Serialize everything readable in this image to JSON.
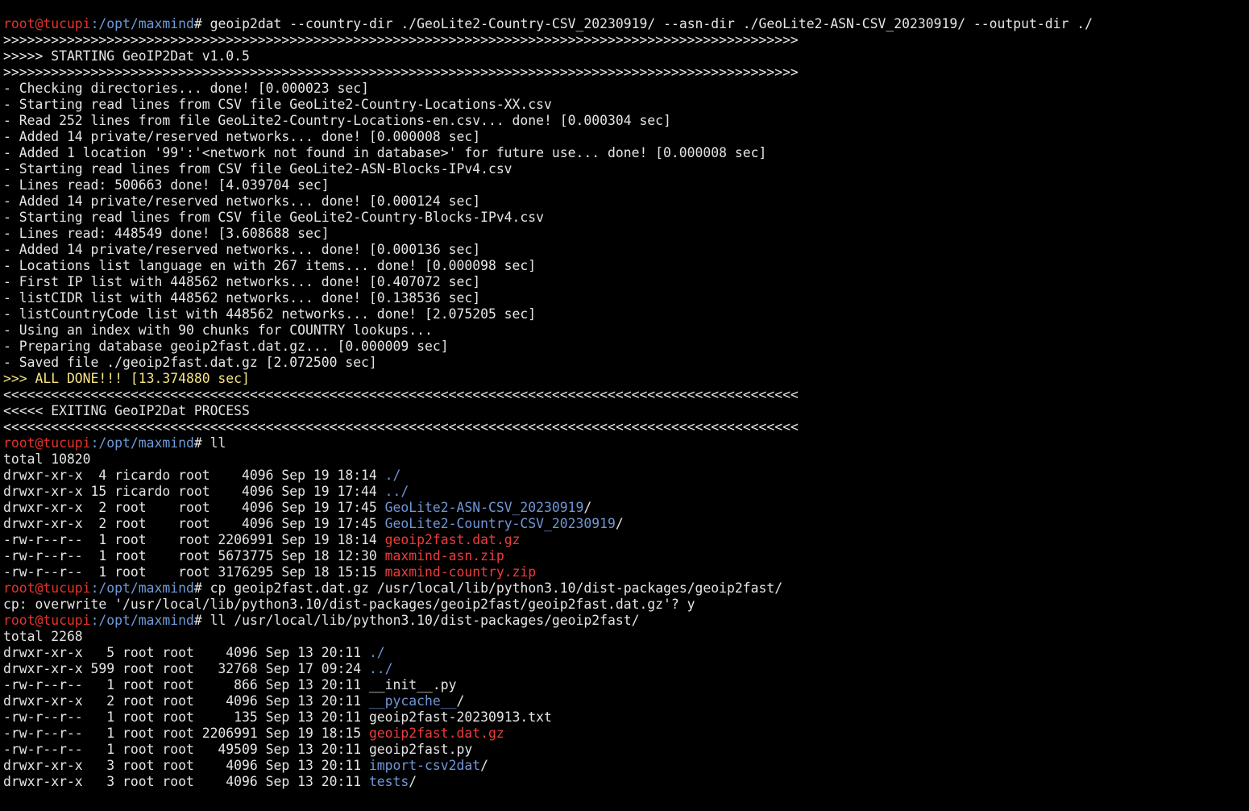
{
  "colors": {
    "background": "#000000",
    "text": "#e5e5e5",
    "prompt_user": "#e5322d",
    "prompt_path": "#6f9bd8",
    "directory": "#7096d6",
    "archive": "#ee3b3b",
    "highlight": "#f7e480"
  },
  "prompt": {
    "user_host": "root@tucupi",
    "path": ":/opt/maxmind",
    "symbol": "# "
  },
  "top_fragment": "    ,     .   ,",
  "lines": [
    {
      "type": "cmd",
      "text": "geoip2dat --country-dir ./GeoLite2-Country-CSV_20230919/ --asn-dir ./GeoLite2-ASN-CSV_20230919/ --output-dir ./"
    },
    {
      "type": "out",
      "text": ">>>>>>>>>>>>>>>>>>>>>>>>>>>>>>>>>>>>>>>>>>>>>>>>>>>>>>>>>>>>>>>>>>>>>>>>>>>>>>>>>>>>>>>>>>>>>>>>>>>>"
    },
    {
      "type": "out",
      "text": ">>>>> STARTING GeoIP2Dat v1.0.5"
    },
    {
      "type": "out",
      "text": ">>>>>>>>>>>>>>>>>>>>>>>>>>>>>>>>>>>>>>>>>>>>>>>>>>>>>>>>>>>>>>>>>>>>>>>>>>>>>>>>>>>>>>>>>>>>>>>>>>>>"
    },
    {
      "type": "out",
      "text": "- Checking directories... done! [0.000023 sec]"
    },
    {
      "type": "out",
      "text": "- Starting read lines from CSV file GeoLite2-Country-Locations-XX.csv"
    },
    {
      "type": "out",
      "text": "- Read 252 lines from file GeoLite2-Country-Locations-en.csv... done! [0.000304 sec]"
    },
    {
      "type": "out",
      "text": "- Added 14 private/reserved networks... done! [0.000008 sec]"
    },
    {
      "type": "out",
      "text": "- Added 1 location '99':'<network not found in database>' for future use... done! [0.000008 sec]"
    },
    {
      "type": "out",
      "text": "- Starting read lines from CSV file GeoLite2-ASN-Blocks-IPv4.csv"
    },
    {
      "type": "out",
      "text": "- Lines read: 500663 done! [4.039704 sec]"
    },
    {
      "type": "out",
      "text": "- Added 14 private/reserved networks... done! [0.000124 sec]"
    },
    {
      "type": "out",
      "text": "- Starting read lines from CSV file GeoLite2-Country-Blocks-IPv4.csv"
    },
    {
      "type": "out",
      "text": "- Lines read: 448549 done! [3.608688 sec]"
    },
    {
      "type": "out",
      "text": "- Added 14 private/reserved networks... done! [0.000136 sec]"
    },
    {
      "type": "out",
      "text": "- Locations list language en with 267 items... done! [0.000098 sec]"
    },
    {
      "type": "out",
      "text": "- First IP list with 448562 networks... done! [0.407072 sec]"
    },
    {
      "type": "out",
      "text": "- listCIDR list with 448562 networks... done! [0.138536 sec]"
    },
    {
      "type": "out",
      "text": "- listCountryCode list with 448562 networks... done! [2.075205 sec]"
    },
    {
      "type": "out",
      "text": "- Using an index with 90 chunks for COUNTRY lookups..."
    },
    {
      "type": "out",
      "text": "- Preparing database geoip2fast.dat.gz... [0.000009 sec]"
    },
    {
      "type": "out",
      "text": "- Saved file ./geoip2fast.dat.gz [2.072500 sec]"
    },
    {
      "type": "highlight",
      "text": ">>> ALL DONE!!! [13.374880 sec]"
    },
    {
      "type": "out",
      "text": "<<<<<<<<<<<<<<<<<<<<<<<<<<<<<<<<<<<<<<<<<<<<<<<<<<<<<<<<<<<<<<<<<<<<<<<<<<<<<<<<<<<<<<<<<<<<<<<<<<<<"
    },
    {
      "type": "out",
      "text": "<<<<< EXITING GeoIP2Dat PROCESS"
    },
    {
      "type": "out",
      "text": "<<<<<<<<<<<<<<<<<<<<<<<<<<<<<<<<<<<<<<<<<<<<<<<<<<<<<<<<<<<<<<<<<<<<<<<<<<<<<<<<<<<<<<<<<<<<<<<<<<<<"
    },
    {
      "type": "cmd",
      "text": "ll"
    },
    {
      "type": "out",
      "text": "total 10820"
    },
    {
      "type": "ls",
      "meta": "drwxr-xr-x  4 ricardo root    4096 Sep 19 18:14 ",
      "name": "./",
      "kind": "dir",
      "suffix": ""
    },
    {
      "type": "ls",
      "meta": "drwxr-xr-x 15 ricardo root    4096 Sep 19 17:44 ",
      "name": "../",
      "kind": "dir",
      "suffix": ""
    },
    {
      "type": "ls",
      "meta": "drwxr-xr-x  2 root    root    4096 Sep 19 17:45 ",
      "name": "GeoLite2-ASN-CSV_20230919",
      "kind": "dir",
      "suffix": "/"
    },
    {
      "type": "ls",
      "meta": "drwxr-xr-x  2 root    root    4096 Sep 19 17:45 ",
      "name": "GeoLite2-Country-CSV_20230919",
      "kind": "dir",
      "suffix": "/"
    },
    {
      "type": "ls",
      "meta": "-rw-r--r--  1 root    root 2206991 Sep 19 18:14 ",
      "name": "geoip2fast.dat.gz",
      "kind": "archive",
      "suffix": ""
    },
    {
      "type": "ls",
      "meta": "-rw-r--r--  1 root    root 5673775 Sep 18 12:30 ",
      "name": "maxmind-asn.zip",
      "kind": "archive",
      "suffix": ""
    },
    {
      "type": "ls",
      "meta": "-rw-r--r--  1 root    root 3176295 Sep 18 15:15 ",
      "name": "maxmind-country.zip",
      "kind": "archive",
      "suffix": ""
    },
    {
      "type": "cmd",
      "text": "cp geoip2fast.dat.gz /usr/local/lib/python3.10/dist-packages/geoip2fast/"
    },
    {
      "type": "out",
      "text": "cp: overwrite '/usr/local/lib/python3.10/dist-packages/geoip2fast/geoip2fast.dat.gz'? y"
    },
    {
      "type": "cmd",
      "text": "ll /usr/local/lib/python3.10/dist-packages/geoip2fast/"
    },
    {
      "type": "out",
      "text": "total 2268"
    },
    {
      "type": "ls",
      "meta": "drwxr-xr-x   5 root root    4096 Sep 13 20:11 ",
      "name": "./",
      "kind": "dir",
      "suffix": ""
    },
    {
      "type": "ls",
      "meta": "drwxr-xr-x 599 root root   32768 Sep 17 09:24 ",
      "name": "../",
      "kind": "dir",
      "suffix": ""
    },
    {
      "type": "ls",
      "meta": "-rw-r--r--   1 root root     866 Sep 13 20:11 ",
      "name": "__init__.py",
      "kind": "file",
      "suffix": ""
    },
    {
      "type": "ls",
      "meta": "drwxr-xr-x   2 root root    4096 Sep 13 20:11 ",
      "name": "__pycache__",
      "kind": "dir",
      "suffix": "/"
    },
    {
      "type": "ls",
      "meta": "-rw-r--r--   1 root root     135 Sep 13 20:11 ",
      "name": "geoip2fast-20230913.txt",
      "kind": "file",
      "suffix": ""
    },
    {
      "type": "ls",
      "meta": "-rw-r--r--   1 root root 2206991 Sep 19 18:15 ",
      "name": "geoip2fast.dat.gz",
      "kind": "archive",
      "suffix": ""
    },
    {
      "type": "ls",
      "meta": "-rw-r--r--   1 root root   49509 Sep 13 20:11 ",
      "name": "geoip2fast.py",
      "kind": "file",
      "suffix": ""
    },
    {
      "type": "ls",
      "meta": "drwxr-xr-x   3 root root    4096 Sep 13 20:11 ",
      "name": "import-csv2dat",
      "kind": "dir",
      "suffix": "/"
    },
    {
      "type": "ls",
      "meta": "drwxr-xr-x   3 root root    4096 Sep 13 20:11 ",
      "name": "tests",
      "kind": "dir",
      "suffix": "/"
    }
  ]
}
